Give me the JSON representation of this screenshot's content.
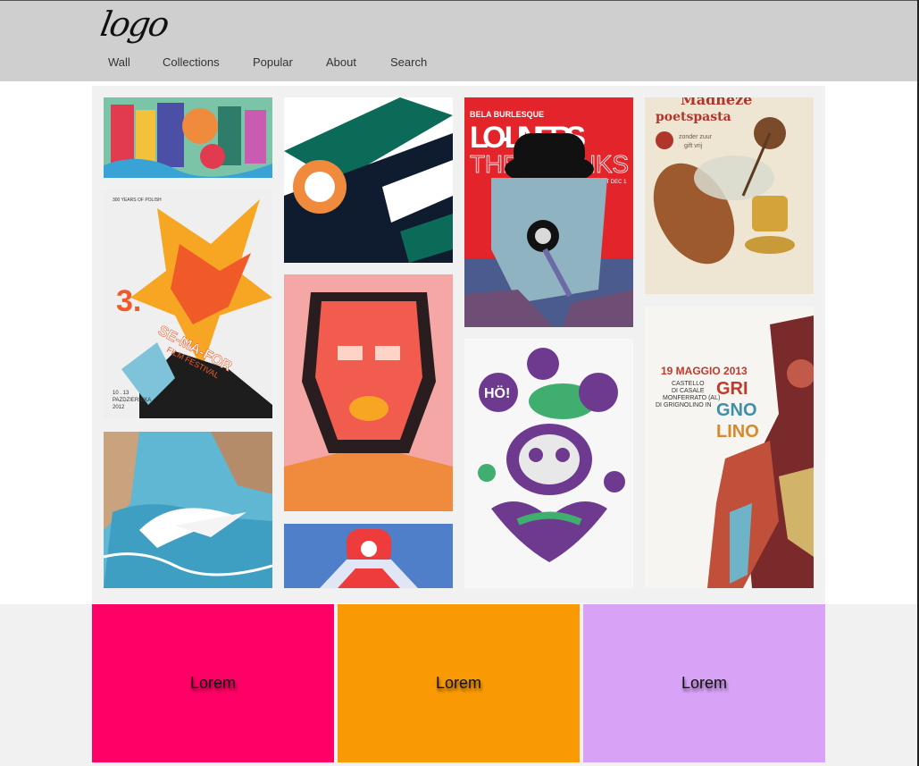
{
  "header": {
    "logo_text": "logo",
    "nav": [
      {
        "label": "Wall"
      },
      {
        "label": "Collections"
      },
      {
        "label": "Popular"
      },
      {
        "label": "About"
      },
      {
        "label": "Search"
      }
    ]
  },
  "gallery": {
    "posters": [
      {
        "subject": "colorful-typography-poster"
      },
      {
        "subject": "biplane-illustration"
      },
      {
        "subject": "lo-liners-poster",
        "lines": [
          "BELA BURLESQUE",
          "LO-LINERS",
          "THE CRANKS",
          "WUNDERBAR SAT DEC 1"
        ]
      },
      {
        "subject": "vintage-fly-toothpaste-ad",
        "lines": [
          "Madheze",
          "poetspasta",
          "zonder zuur",
          "gift vrij"
        ]
      },
      {
        "subject": "semafor-film-festival-poster",
        "lines": [
          "3.",
          "SE-MA-FOR",
          "FILM FESTIVAL",
          "10 . 13",
          "PAZDZIERNIKA",
          "2012"
        ]
      },
      {
        "subject": "red-mask-face-illustration"
      },
      {
        "subject": "purple-graffiti-skull",
        "lines": [
          "HÖ!"
        ]
      },
      {
        "subject": "grignolino-wine-poster",
        "lines": [
          "19 MAGGIO 2013",
          "CASTELLO",
          "DI CASALE",
          "MONFERRATO (AL)",
          "DI GRIGNOLINO IN",
          "GRI",
          "GNO",
          "LINO"
        ]
      },
      {
        "subject": "seaside-bird-illustration"
      },
      {
        "subject": "robot-character-illustration"
      }
    ]
  },
  "footer": {
    "panels": [
      {
        "label": "Lorem",
        "color": "#ff0066"
      },
      {
        "label": "Lorem",
        "color": "#f99a05"
      },
      {
        "label": "Lorem",
        "color": "#d8a3f7"
      }
    ]
  },
  "colors": {
    "header_bg": "#cfcfcf",
    "gallery_bg": "#f1f1f1"
  }
}
